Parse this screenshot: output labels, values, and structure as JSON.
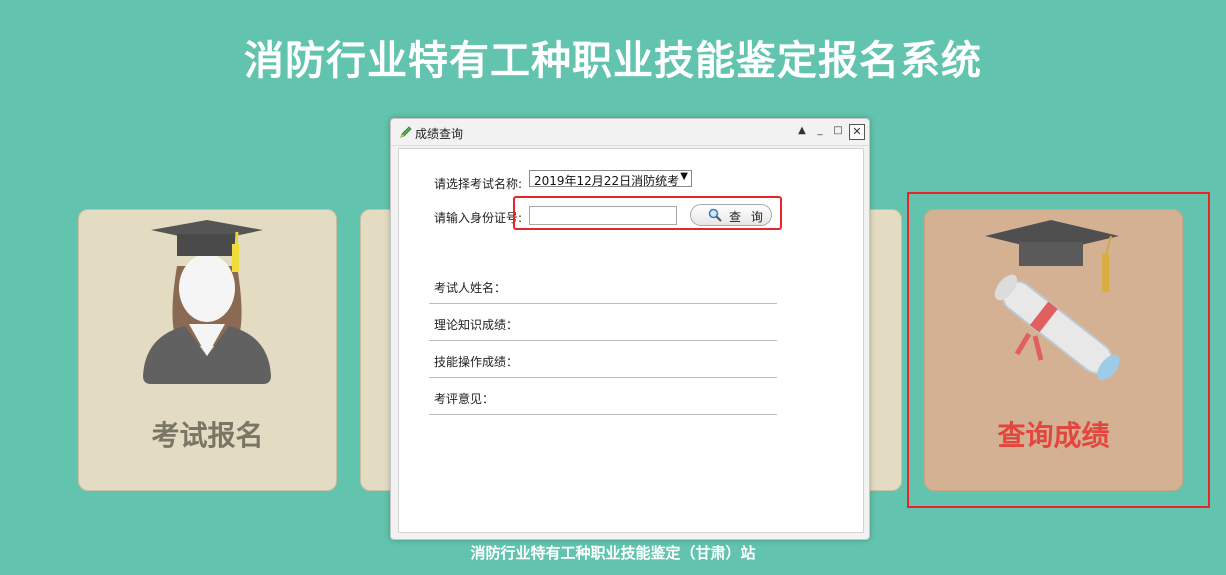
{
  "page": {
    "title": "消防行业特有工种职业技能鉴定报名系统",
    "footer": "消防行业特有工种职业技能鉴定（甘肃）站"
  },
  "cards": {
    "register_label": "考试报名",
    "query_label": "查询成绩"
  },
  "dialog": {
    "title": "成绩查询",
    "exam_label": "请选择考试名称:",
    "exam_selected": "2019年12月22日消防统考",
    "id_label": "请输入身份证号:",
    "id_value": "",
    "query_button": "查 询",
    "results": [
      {
        "label": "考试人姓名："
      },
      {
        "label": "理论知识成绩："
      },
      {
        "label": "技能操作成绩："
      },
      {
        "label": "考评意见："
      }
    ]
  },
  "colors": {
    "background": "#62c4ae",
    "card_neutral": "#e4dcc2",
    "card_active": "#d4b193",
    "highlight": "#e8262a",
    "active_label": "#e2463f"
  },
  "icons": {
    "student": "graduate-student-icon",
    "diploma": "graduation-cap-diploma-icon",
    "edit": "pencil-icon",
    "search": "magnifier-icon"
  }
}
